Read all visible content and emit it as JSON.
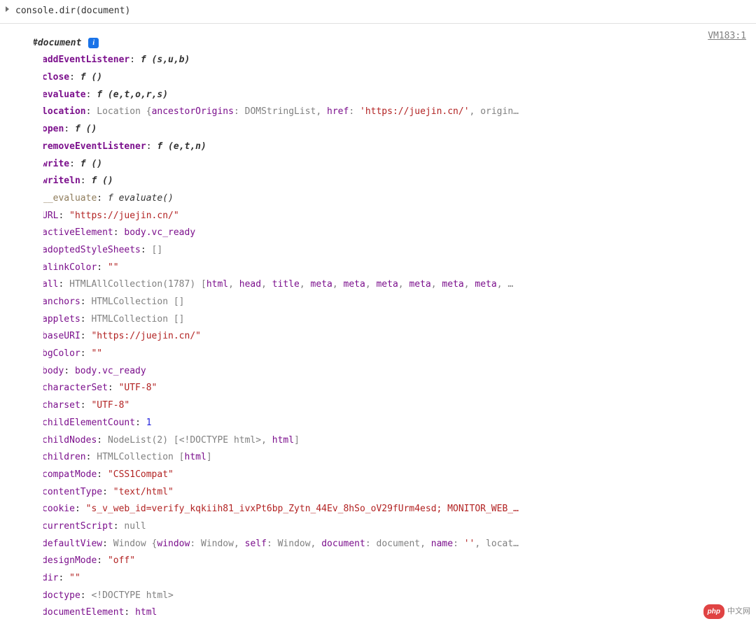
{
  "prompt": "console.dir(document)",
  "vm_link": "VM183:1",
  "root_label": "#document",
  "rows": [
    {
      "exp": "▶",
      "kcls": "k-bold",
      "key": "addEventListener",
      "sep": ": ",
      "val_html": "<span class='f-sig'>f (s,u,b)</span>"
    },
    {
      "exp": "▶",
      "kcls": "k-bold",
      "key": "close",
      "sep": ": ",
      "val_html": "<span class='f-sig'>f ()</span>"
    },
    {
      "exp": "▶",
      "kcls": "k-bold",
      "key": "evaluate",
      "sep": ": ",
      "val_html": "<span class='f-sig'>f (e,t,o,r,s)</span>"
    },
    {
      "exp": "▶",
      "kcls": "k-bold",
      "key": "location",
      "sep": ": ",
      "val_html": "<span class='val-type'>Location</span><span class='val-type'> {</span><span class='k'>ancestorOrigins</span><span class='val-type'>: DOMStringList, </span><span class='k'>href</span><span class='val-type'>: </span><span class='val-str'>'https://juejin.cn/'</span><span class='val-type'>, origin…</span>"
    },
    {
      "exp": "▶",
      "kcls": "k-bold",
      "key": "open",
      "sep": ": ",
      "val_html": "<span class='f-sig'>f ()</span>"
    },
    {
      "exp": "▶",
      "kcls": "k-bold",
      "key": "removeEventListener",
      "sep": ": ",
      "val_html": "<span class='f-sig'>f (e,t,n)</span>"
    },
    {
      "exp": "▶",
      "kcls": "k-bold",
      "key": "write",
      "sep": ": ",
      "val_html": "<span class='f-sig'>f ()</span>"
    },
    {
      "exp": "▶",
      "kcls": "k-bold",
      "key": "writeln",
      "sep": ": ",
      "val_html": "<span class='f-sig'>f ()</span>"
    },
    {
      "exp": "▶",
      "kcls": "k-light",
      "key": "__evaluate",
      "sep": ": ",
      "val_html": "<span class='f-sig-light'>f evaluate()</span>"
    },
    {
      "exp": "",
      "kcls": "k",
      "key": "URL",
      "sep": ": ",
      "val_html": "<span class='val-str'>\"https://juejin.cn/\"</span>"
    },
    {
      "exp": "▶",
      "kcls": "k",
      "key": "activeElement",
      "sep": ": ",
      "val_html": "<span class='k'>body.vc_ready</span>"
    },
    {
      "exp": "▶",
      "kcls": "k",
      "key": "adoptedStyleSheets",
      "sep": ": ",
      "val_html": "<span class='val-type'>[]</span>"
    },
    {
      "exp": "",
      "kcls": "k",
      "key": "alinkColor",
      "sep": ": ",
      "val_html": "<span class='val-str'>\"\"</span>"
    },
    {
      "exp": "▶",
      "kcls": "k",
      "key": "all",
      "sep": ": ",
      "val_html": "<span class='val-type'>HTMLAllCollection(1787) [</span><span class='k'>html</span><span class='val-type'>, </span><span class='k'>head</span><span class='val-type'>, </span><span class='k'>title</span><span class='val-type'>, </span><span class='k'>meta</span><span class='val-type'>, </span><span class='k'>meta</span><span class='val-type'>, </span><span class='k'>meta</span><span class='val-type'>, </span><span class='k'>meta</span><span class='val-type'>, </span><span class='k'>meta</span><span class='val-type'>, </span><span class='k'>meta</span><span class='val-type'>, …</span>"
    },
    {
      "exp": "▶",
      "kcls": "k",
      "key": "anchors",
      "sep": ": ",
      "val_html": "<span class='val-type'>HTMLCollection []</span>"
    },
    {
      "exp": "▶",
      "kcls": "k",
      "key": "applets",
      "sep": ": ",
      "val_html": "<span class='val-type'>HTMLCollection []</span>"
    },
    {
      "exp": "",
      "kcls": "k",
      "key": "baseURI",
      "sep": ": ",
      "val_html": "<span class='val-str'>\"https://juejin.cn/\"</span>"
    },
    {
      "exp": "",
      "kcls": "k",
      "key": "bgColor",
      "sep": ": ",
      "val_html": "<span class='val-str'>\"\"</span>"
    },
    {
      "exp": "▶",
      "kcls": "k",
      "key": "body",
      "sep": ": ",
      "val_html": "<span class='k'>body.vc_ready</span>"
    },
    {
      "exp": "",
      "kcls": "k",
      "key": "characterSet",
      "sep": ": ",
      "val_html": "<span class='val-str'>\"UTF-8\"</span>"
    },
    {
      "exp": "",
      "kcls": "k",
      "key": "charset",
      "sep": ": ",
      "val_html": "<span class='val-str'>\"UTF-8\"</span>"
    },
    {
      "exp": "",
      "kcls": "k",
      "key": "childElementCount",
      "sep": ": ",
      "val_html": "<span class='val-num'>1</span>"
    },
    {
      "exp": "▶",
      "kcls": "k",
      "key": "childNodes",
      "sep": ": ",
      "val_html": "<span class='val-type'>NodeList(2) [</span><span class='val-html'>&lt;!DOCTYPE html&gt;</span><span class='val-type'>, </span><span class='k'>html</span><span class='val-type'>]</span>"
    },
    {
      "exp": "▶",
      "kcls": "k",
      "key": "children",
      "sep": ": ",
      "val_html": "<span class='val-type'>HTMLCollection [</span><span class='k'>html</span><span class='val-type'>]</span>"
    },
    {
      "exp": "",
      "kcls": "k",
      "key": "compatMode",
      "sep": ": ",
      "val_html": "<span class='val-str'>\"CSS1Compat\"</span>"
    },
    {
      "exp": "",
      "kcls": "k",
      "key": "contentType",
      "sep": ": ",
      "val_html": "<span class='val-str'>\"text/html\"</span>"
    },
    {
      "exp": "",
      "kcls": "k",
      "key": "cookie",
      "sep": ": ",
      "val_html": "<span class='val-str'>\"s_v_web_id=verify_kqkiih81_ivxPt6bp_Zytn_44Ev_8hSo_oV29fUrm4esd; MONITOR_WEB_…</span>"
    },
    {
      "exp": "",
      "kcls": "k",
      "key": "currentScript",
      "sep": ": ",
      "val_html": "<span class='val-grey'>null</span>"
    },
    {
      "exp": "▶",
      "kcls": "k",
      "key": "defaultView",
      "sep": ": ",
      "val_html": "<span class='val-type'>Window {</span><span class='k'>window</span><span class='val-type'>: Window, </span><span class='k'>self</span><span class='val-type'>: Window, </span><span class='k'>document</span><span class='val-type'>: document, </span><span class='k'>name</span><span class='val-type'>: </span><span class='val-str'>''</span><span class='val-type'>, locat…</span>"
    },
    {
      "exp": "",
      "kcls": "k",
      "key": "designMode",
      "sep": ": ",
      "val_html": "<span class='val-str'>\"off\"</span>"
    },
    {
      "exp": "",
      "kcls": "k",
      "key": "dir",
      "sep": ": ",
      "val_html": "<span class='val-str'>\"\"</span>"
    },
    {
      "exp": "▶",
      "kcls": "k",
      "key": "doctype",
      "sep": ": ",
      "val_html": "<span class='val-html'>&lt;!DOCTYPE html&gt;</span>"
    },
    {
      "exp": "▶",
      "kcls": "k",
      "key": "documentElement",
      "sep": ": ",
      "val_html": "<span class='k'>html</span>"
    }
  ],
  "watermark": {
    "badge": "php",
    "text": "中文网"
  }
}
